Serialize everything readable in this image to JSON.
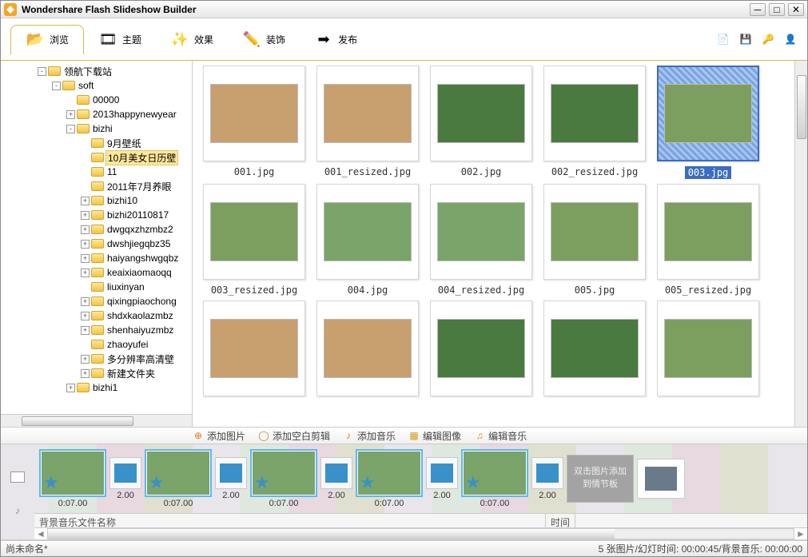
{
  "title": "Wondershare  Flash Slideshow Builder",
  "tabs": [
    {
      "label": "浏览",
      "icon": "folder-icon",
      "active": true
    },
    {
      "label": "主题",
      "icon": "filmstrip-icon"
    },
    {
      "label": "效果",
      "icon": "sparkle-icon"
    },
    {
      "label": "装饰",
      "icon": "pencil-icon"
    },
    {
      "label": "发布",
      "icon": "export-icon"
    }
  ],
  "tree": [
    {
      "depth": 0,
      "tw": "-",
      "label": "领航下载站"
    },
    {
      "depth": 1,
      "tw": "-",
      "label": "soft"
    },
    {
      "depth": 2,
      "tw": "",
      "label": "00000"
    },
    {
      "depth": 2,
      "tw": "+",
      "label": "2013happynewyear"
    },
    {
      "depth": 2,
      "tw": "-",
      "label": "bizhi"
    },
    {
      "depth": 3,
      "tw": "",
      "label": "9月壁纸"
    },
    {
      "depth": 3,
      "tw": "",
      "label": "10月美女日历壁",
      "sel": true
    },
    {
      "depth": 3,
      "tw": "",
      "label": "11"
    },
    {
      "depth": 3,
      "tw": "",
      "label": "2011年7月养眼"
    },
    {
      "depth": 3,
      "tw": "+",
      "label": "bizhi10"
    },
    {
      "depth": 3,
      "tw": "+",
      "label": "bizhi20110817"
    },
    {
      "depth": 3,
      "tw": "+",
      "label": "dwgqxzhzmbz2"
    },
    {
      "depth": 3,
      "tw": "+",
      "label": "dwshjiegqbz35"
    },
    {
      "depth": 3,
      "tw": "+",
      "label": "haiyangshwgqbz"
    },
    {
      "depth": 3,
      "tw": "+",
      "label": "keaixiaomaoqq"
    },
    {
      "depth": 3,
      "tw": "",
      "label": "liuxinyan"
    },
    {
      "depth": 3,
      "tw": "+",
      "label": "qixingpiaochong"
    },
    {
      "depth": 3,
      "tw": "+",
      "label": "shdxkaolazmbz"
    },
    {
      "depth": 3,
      "tw": "+",
      "label": "shenhaiyuzmbz"
    },
    {
      "depth": 3,
      "tw": "",
      "label": "zhaoyufei"
    },
    {
      "depth": 3,
      "tw": "+",
      "label": "多分辨率高清壁"
    },
    {
      "depth": 3,
      "tw": "+",
      "label": "新建文件夹"
    },
    {
      "depth": 2,
      "tw": "+",
      "label": "bizhi1"
    }
  ],
  "thumbs": [
    {
      "name": "001.jpg",
      "cls": "alt1"
    },
    {
      "name": "001_resized.jpg",
      "cls": "alt1"
    },
    {
      "name": "002.jpg",
      "cls": "alt2"
    },
    {
      "name": "002_resized.jpg",
      "cls": "alt2"
    },
    {
      "name": "003.jpg",
      "cls": "alt3",
      "selected": true
    },
    {
      "name": "003_resized.jpg",
      "cls": "alt3"
    },
    {
      "name": "004.jpg",
      "cls": ""
    },
    {
      "name": "004_resized.jpg",
      "cls": ""
    },
    {
      "name": "005.jpg",
      "cls": "alt3"
    },
    {
      "name": "005_resized.jpg",
      "cls": "alt3"
    },
    {
      "name": "",
      "cls": "alt1"
    },
    {
      "name": "",
      "cls": "alt1"
    },
    {
      "name": "",
      "cls": "alt2"
    },
    {
      "name": "",
      "cls": "alt2"
    },
    {
      "name": "",
      "cls": "alt3"
    }
  ],
  "actions": {
    "add_photo": "添加图片",
    "add_blank": "添加空白剪辑",
    "add_music": "添加音乐",
    "edit_image": "编辑图像",
    "edit_music": "编辑音乐"
  },
  "timeline": [
    {
      "type": "photo",
      "dur": "0:07.00"
    },
    {
      "type": "trans",
      "dur": "2.00"
    },
    {
      "type": "photo",
      "dur": "0:07.00"
    },
    {
      "type": "trans",
      "dur": "2.00"
    },
    {
      "type": "photo",
      "dur": "0:07.00"
    },
    {
      "type": "trans",
      "dur": "2.00"
    },
    {
      "type": "photo",
      "dur": "0:07.00"
    },
    {
      "type": "trans",
      "dur": "2.00"
    },
    {
      "type": "photo",
      "dur": "0:07.00"
    },
    {
      "type": "trans",
      "dur": "2.00"
    },
    {
      "type": "drop",
      "text": "双击图片添加到情节板"
    },
    {
      "type": "blank"
    }
  ],
  "music_header": {
    "col1": "背景音乐文件名称",
    "col2": "时间"
  },
  "status": {
    "left": "尚未命名*",
    "right": "5 张图片/幻灯时间: 00:00:45/背景音乐: 00:00:00"
  }
}
